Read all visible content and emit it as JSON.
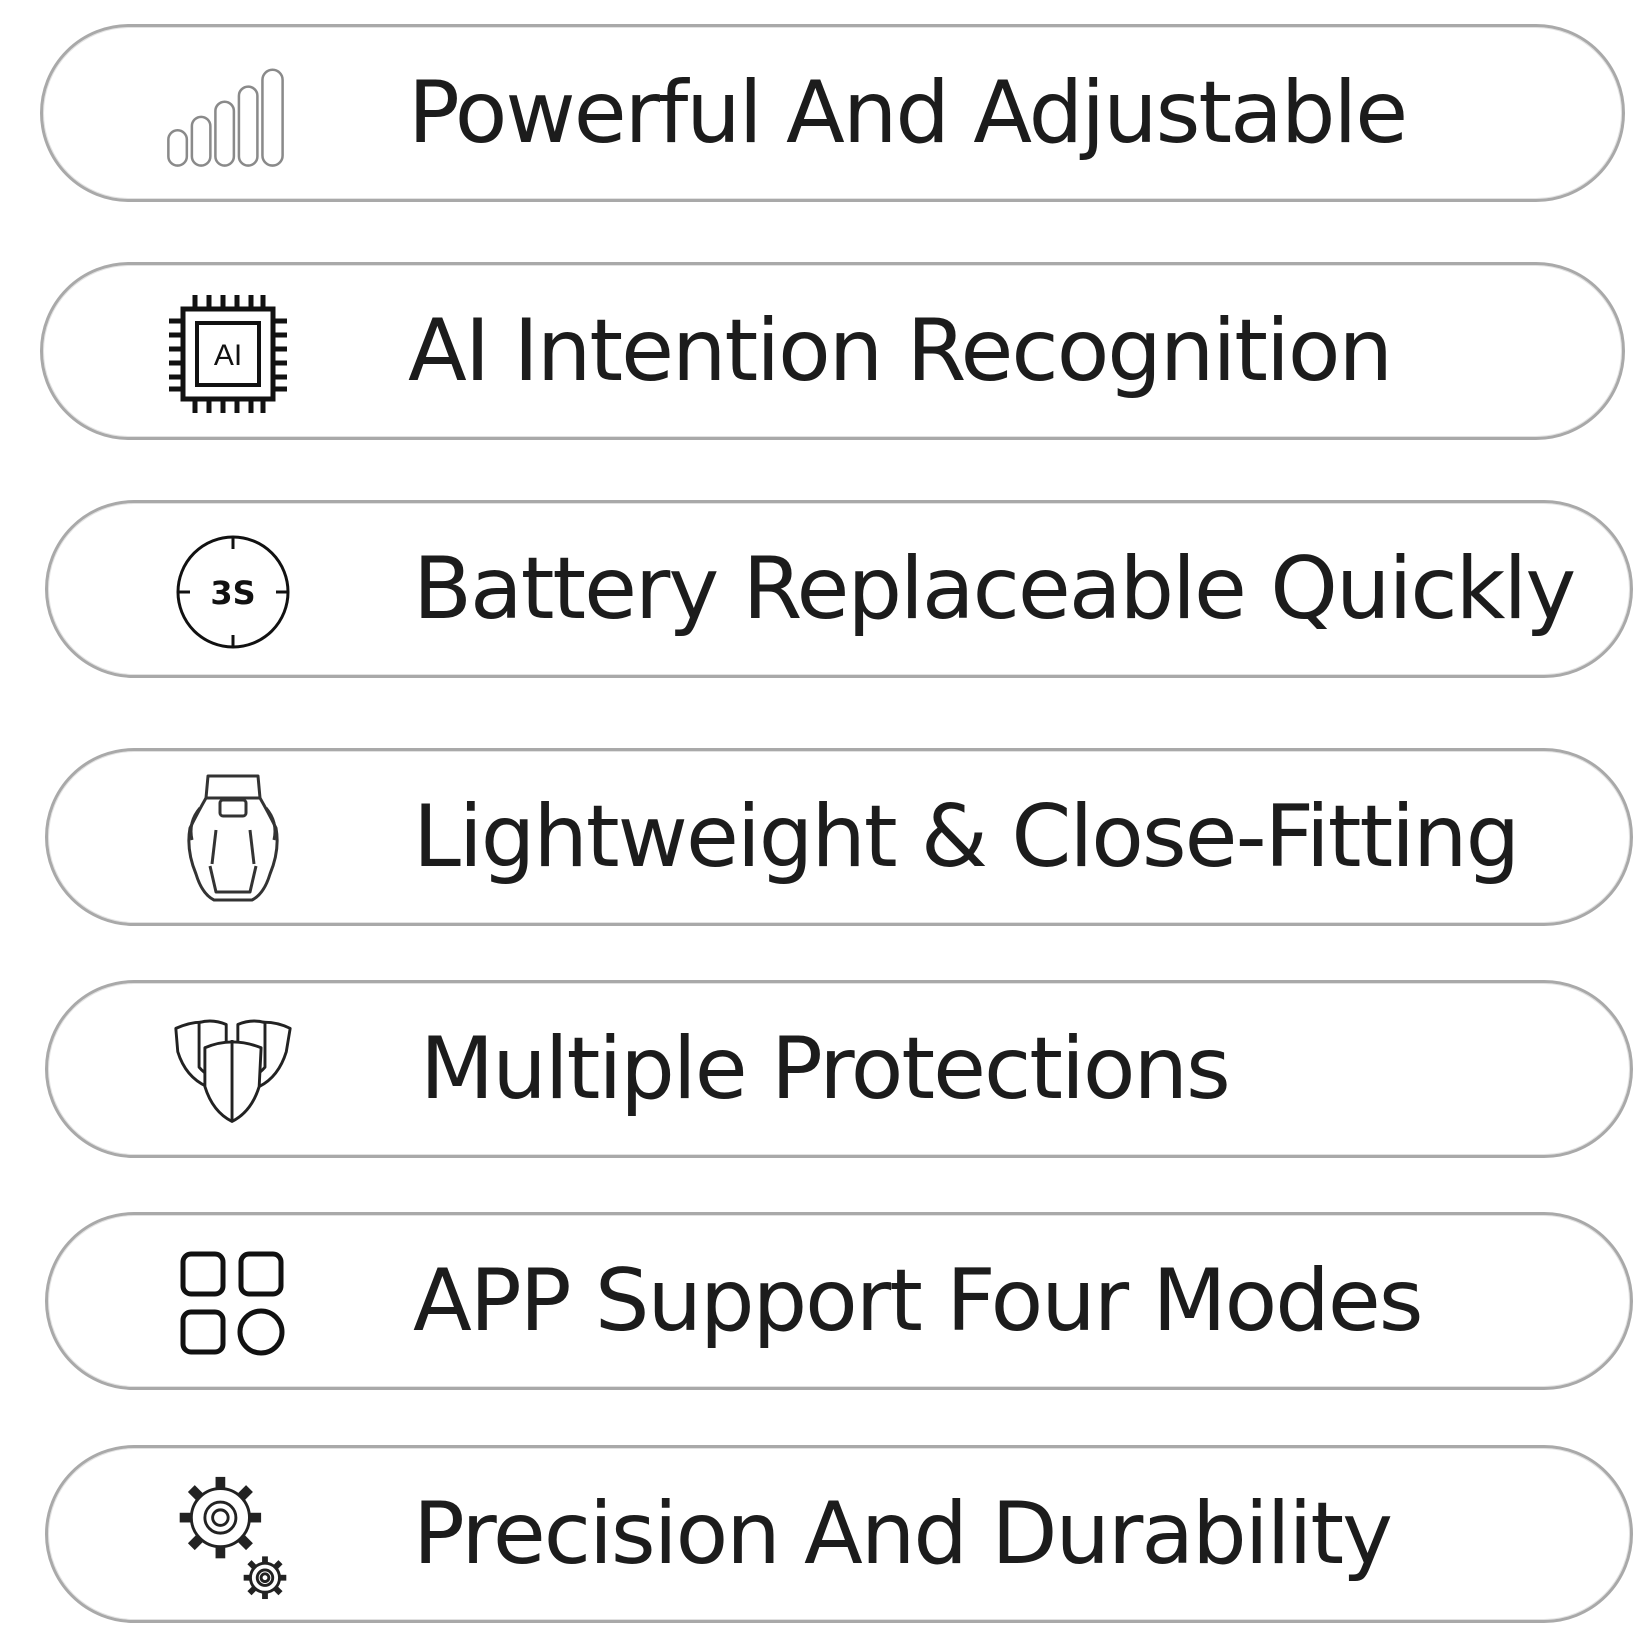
{
  "features": [
    {
      "icon": "signal-bars-icon",
      "label": "Powerful And Adjustable"
    },
    {
      "icon": "ai-chip-icon",
      "chip_text": "AI",
      "label": "AI Intention Recognition"
    },
    {
      "icon": "timer-3s-icon",
      "timer_text": "3S",
      "label": "Battery Replaceable Quickly"
    },
    {
      "icon": "hip-exoskeleton-icon",
      "label": "Lightweight & Close-Fitting"
    },
    {
      "icon": "shields-icon",
      "label": "Multiple Protections"
    },
    {
      "icon": "four-modes-grid-icon",
      "label": "APP Support Four Modes"
    },
    {
      "icon": "gears-icon",
      "label": "Precision And Durability"
    }
  ],
  "colors": {
    "pill_border": "#a9a9a9",
    "text": "#1c1c1c",
    "icon_light": "#8a8a8a",
    "icon_dark": "#111111"
  }
}
